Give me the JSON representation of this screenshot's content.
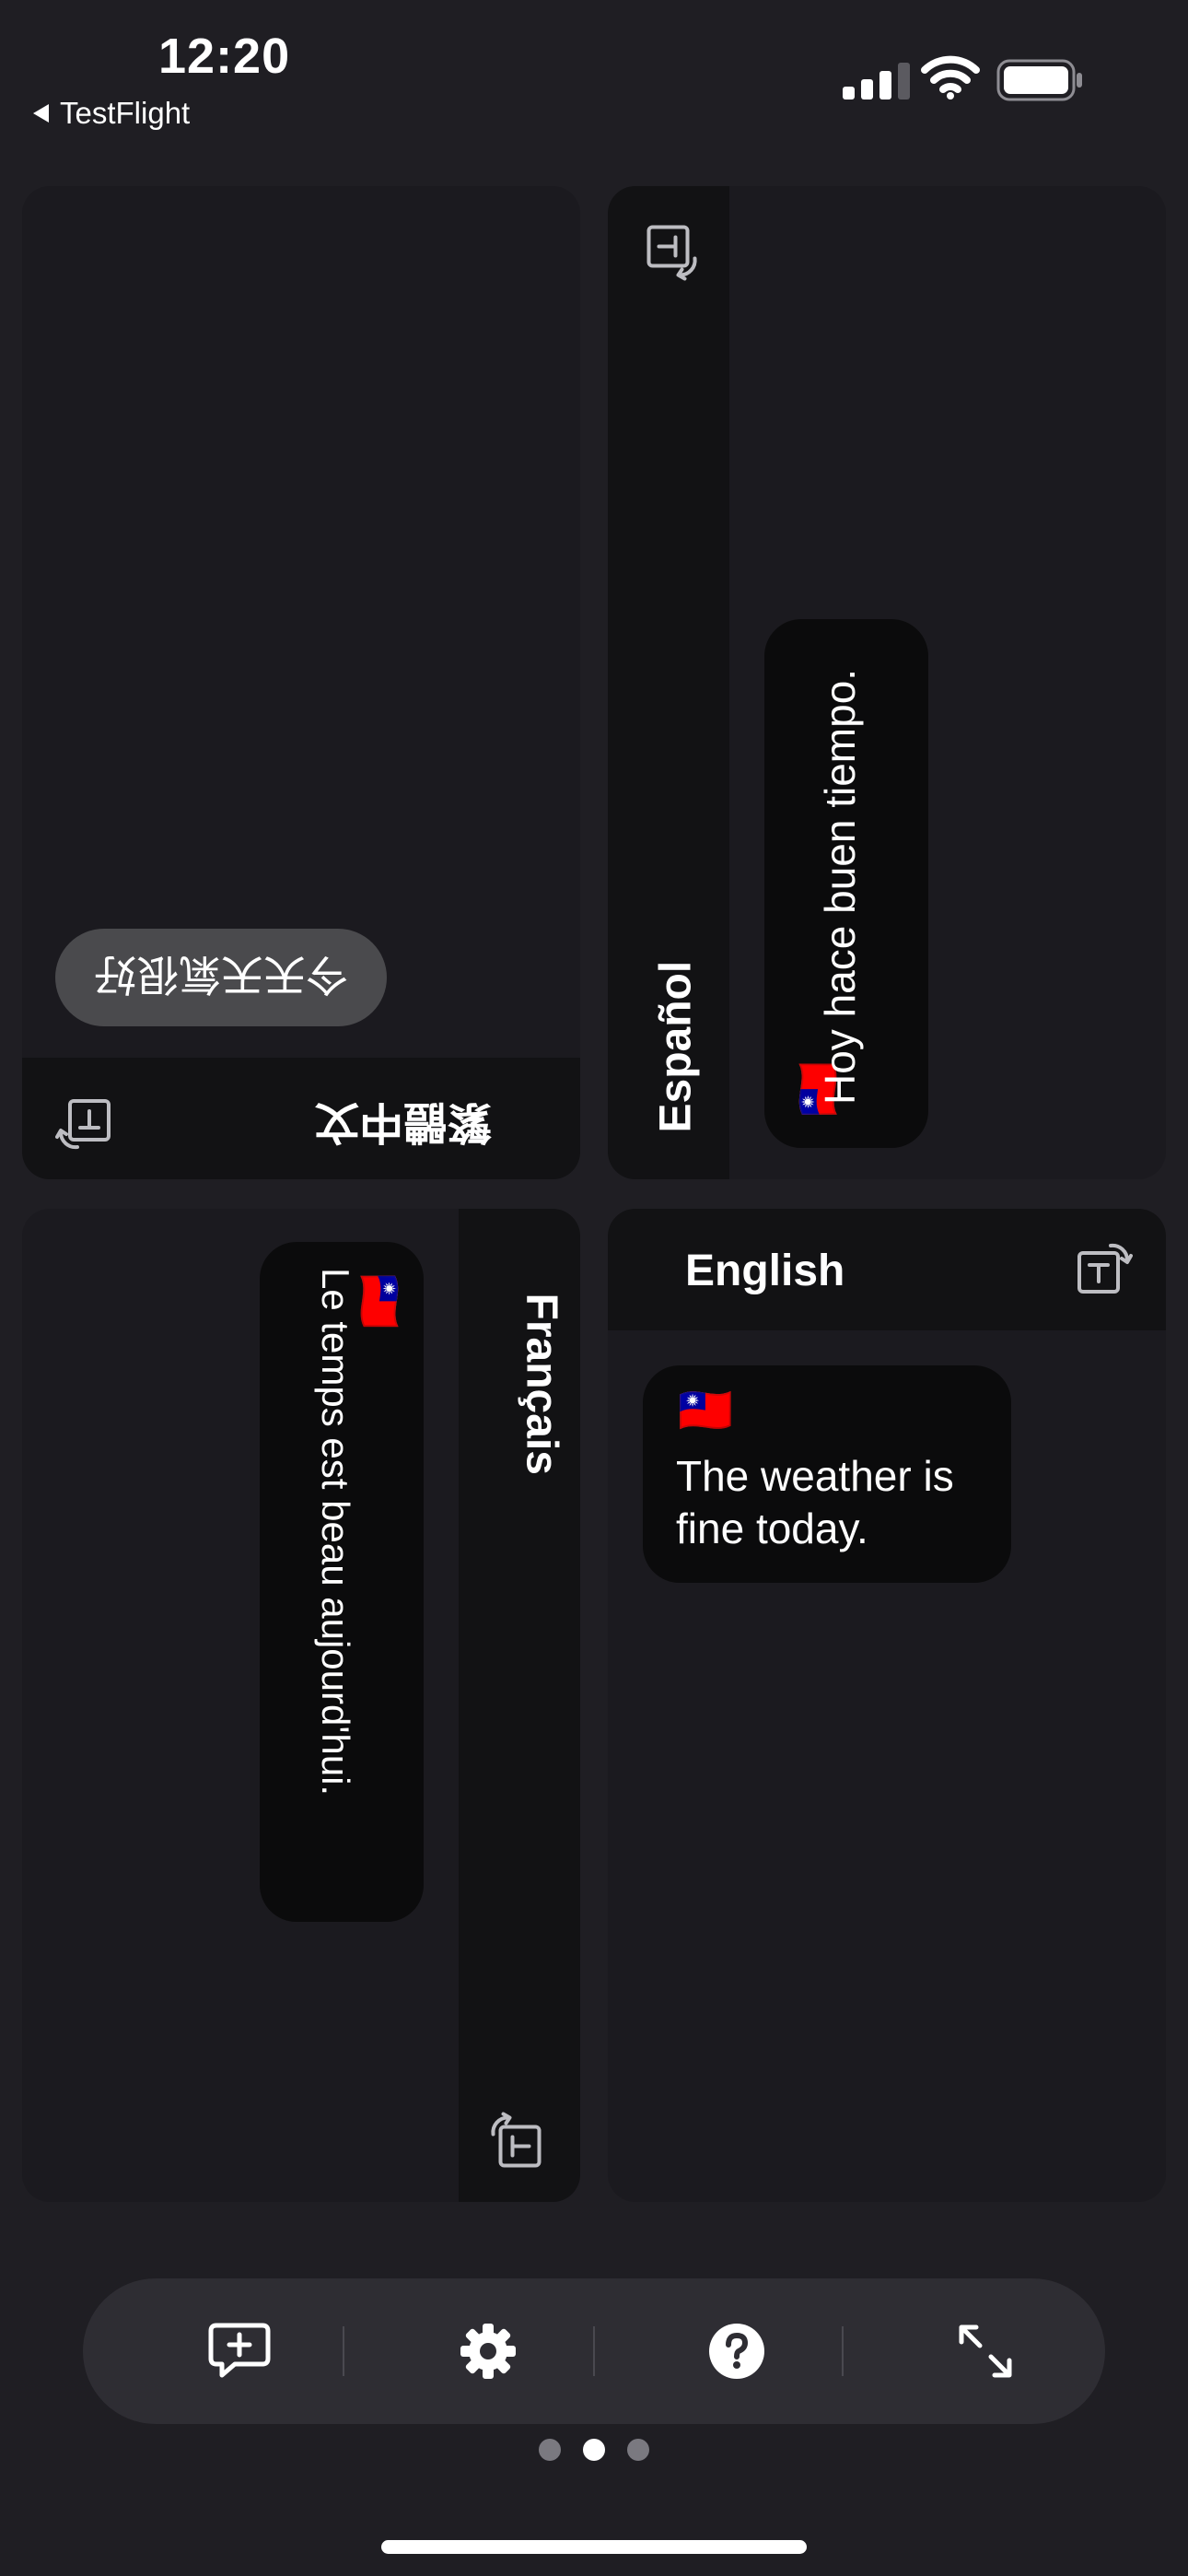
{
  "status_bar": {
    "time": "12:20",
    "back_label": "TestFlight"
  },
  "panels": {
    "chinese": {
      "language": "繁體中文",
      "message": "今天天氣很好"
    },
    "spanish": {
      "language": "Español",
      "message": "Hoy hace buen tiempo.",
      "flag": "🇹🇼"
    },
    "french": {
      "language": "Français",
      "message": "Le temps est beau aujourd'hui.",
      "flag": "🇹🇼"
    },
    "english": {
      "language": "English",
      "message": "The weather is fine today.",
      "flag": "🇹🇼"
    }
  },
  "toolbar": {
    "icons": [
      "add-chat-icon",
      "gear-icon",
      "help-icon",
      "expand-icon"
    ]
  },
  "page_indicator": {
    "count": 3,
    "active_index": 1
  },
  "colors": {
    "background": "#1f1e23",
    "panel": "#1b1a1f",
    "header_bar": "#121214",
    "bubble": "#0b0b0c",
    "chinese_bubble": "#4a4a4d",
    "toolbar": "#2e2d33"
  }
}
